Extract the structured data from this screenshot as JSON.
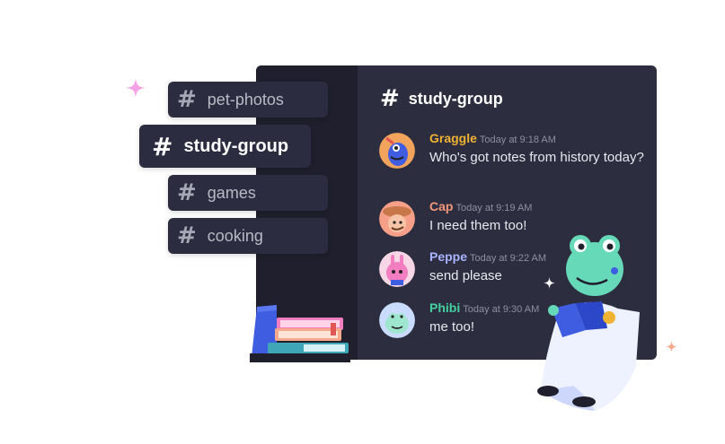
{
  "channels": [
    {
      "name": "pet-photos",
      "active": false
    },
    {
      "name": "study-group",
      "active": true
    },
    {
      "name": "games",
      "active": false
    },
    {
      "name": "cooking",
      "active": false
    }
  ],
  "header": {
    "hash": "#",
    "title": "study-group"
  },
  "messages": [
    {
      "author": "Graggle",
      "time": "Today at 9:18 AM",
      "text": "Who's got notes from history today?",
      "name_color": "#f0b232",
      "avatar_color": "#3f5de0"
    },
    {
      "author": "Cap",
      "time": "Today at 9:19 AM",
      "text": "I need them too!",
      "name_color": "#f4977a",
      "avatar_color": "#f6a08a"
    },
    {
      "author": "Peppe",
      "time": "Today at 9:22 AM",
      "text": "send please",
      "name_color": "#aab3ff",
      "avatar_color": "#f7b9d7"
    },
    {
      "author": "Phibi",
      "time": "Today at 9:30 AM",
      "text": "me too!",
      "name_color": "#45d1a1",
      "avatar_color": "#c9dcff"
    }
  ],
  "colors": {
    "window_bg": "#2c2d3f",
    "sidebar_bg": "#1f1f2d",
    "pill_bg": "#2b2c40"
  }
}
